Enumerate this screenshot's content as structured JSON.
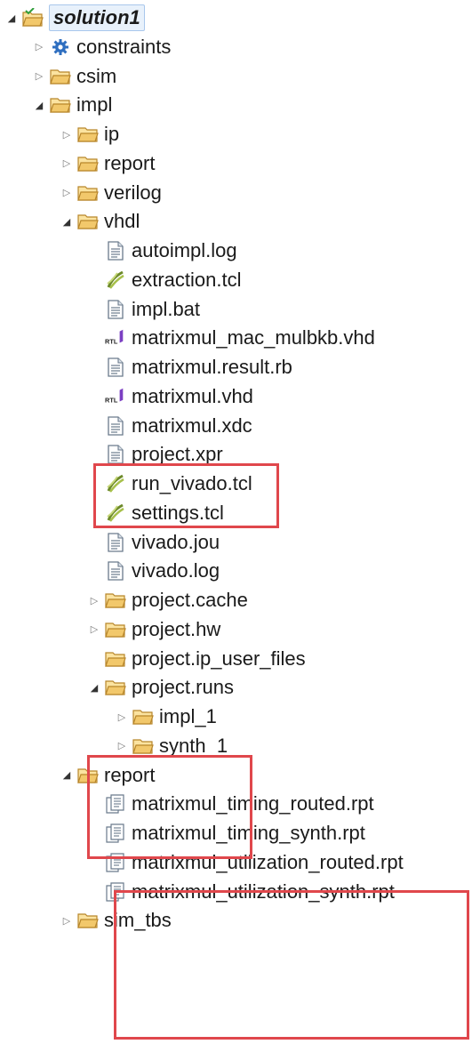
{
  "tree": [
    {
      "label": "solution1",
      "icon": "project-folder-icon",
      "twisty": "expanded",
      "level": 0,
      "root": true
    },
    {
      "label": "constraints",
      "icon": "gear-icon",
      "twisty": "collapsed",
      "level": 1
    },
    {
      "label": "csim",
      "icon": "folder-icon",
      "twisty": "collapsed",
      "level": 1
    },
    {
      "label": "impl",
      "icon": "folder-icon",
      "twisty": "expanded",
      "level": 1
    },
    {
      "label": "ip",
      "icon": "folder-icon",
      "twisty": "collapsed",
      "level": 2
    },
    {
      "label": "report",
      "icon": "folder-icon",
      "twisty": "collapsed",
      "level": 2
    },
    {
      "label": "verilog",
      "icon": "folder-icon",
      "twisty": "collapsed",
      "level": 2
    },
    {
      "label": "vhdl",
      "icon": "folder-icon",
      "twisty": "expanded",
      "level": 2
    },
    {
      "label": "autoimpl.log",
      "icon": "text-file-icon",
      "twisty": "none",
      "level": 3
    },
    {
      "label": "extraction.tcl",
      "icon": "tcl-script-icon",
      "twisty": "none",
      "level": 3
    },
    {
      "label": "impl.bat",
      "icon": "text-file-icon",
      "twisty": "none",
      "level": 3
    },
    {
      "label": "matrixmul_mac_mulbkb.vhd",
      "icon": "rtl-file-icon",
      "twisty": "none",
      "level": 3
    },
    {
      "label": "matrixmul.result.rb",
      "icon": "text-file-icon",
      "twisty": "none",
      "level": 3
    },
    {
      "label": "matrixmul.vhd",
      "icon": "rtl-file-icon",
      "twisty": "none",
      "level": 3
    },
    {
      "label": "matrixmul.xdc",
      "icon": "text-file-icon",
      "twisty": "none",
      "level": 3
    },
    {
      "label": "project.xpr",
      "icon": "text-file-icon",
      "twisty": "none",
      "level": 3
    },
    {
      "label": "run_vivado.tcl",
      "icon": "tcl-script-icon",
      "twisty": "none",
      "level": 3
    },
    {
      "label": "settings.tcl",
      "icon": "tcl-script-icon",
      "twisty": "none",
      "level": 3
    },
    {
      "label": "vivado.jou",
      "icon": "text-file-icon",
      "twisty": "none",
      "level": 3
    },
    {
      "label": "vivado.log",
      "icon": "text-file-icon",
      "twisty": "none",
      "level": 3
    },
    {
      "label": "project.cache",
      "icon": "folder-icon",
      "twisty": "collapsed",
      "level": 3
    },
    {
      "label": "project.hw",
      "icon": "folder-icon",
      "twisty": "collapsed",
      "level": 3
    },
    {
      "label": "project.ip_user_files",
      "icon": "folder-icon",
      "twisty": "none",
      "level": 3
    },
    {
      "label": "project.runs",
      "icon": "folder-icon",
      "twisty": "expanded",
      "level": 3
    },
    {
      "label": "impl_1",
      "icon": "folder-icon",
      "twisty": "collapsed",
      "level": 4
    },
    {
      "label": "synth_1",
      "icon": "folder-icon",
      "twisty": "collapsed",
      "level": 4
    },
    {
      "label": "report",
      "icon": "folder-icon",
      "twisty": "expanded",
      "level": 2
    },
    {
      "label": "matrixmul_timing_routed.rpt",
      "icon": "report-file-icon",
      "twisty": "none",
      "level": 3
    },
    {
      "label": "matrixmul_timing_synth.rpt",
      "icon": "report-file-icon",
      "twisty": "none",
      "level": 3
    },
    {
      "label": "matrixmul_utilization_routed.rpt",
      "icon": "report-file-icon",
      "twisty": "none",
      "level": 3
    },
    {
      "label": "matrixmul_utilization_synth.rpt",
      "icon": "report-file-icon",
      "twisty": "none",
      "level": 3
    },
    {
      "label": "sim_tbs",
      "icon": "folder-icon",
      "twisty": "collapsed",
      "level": 2
    }
  ],
  "colors": {
    "highlight_box": "#e0474c",
    "folder": "#f2c86b",
    "selection": "#e8f1fb"
  },
  "icons": {
    "rtl_badge": "RTL"
  }
}
